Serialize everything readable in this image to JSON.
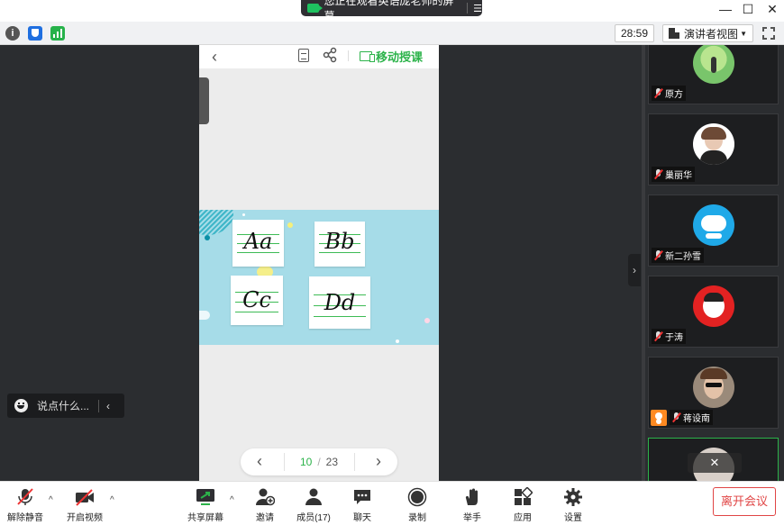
{
  "window": {
    "share_banner": "您正在观看英语庞老师的屏幕",
    "share_banner_menu": "☰",
    "minimize": "—",
    "maximize": "☐",
    "close": "✕"
  },
  "infobar": {
    "info_icon": "i",
    "timer": "28:59",
    "view_mode": "演讲者视图"
  },
  "shared_screen": {
    "mobile_teach": "移动授课",
    "cards": [
      "Aa",
      "Bb",
      "Cc",
      "Dd"
    ],
    "pager": {
      "current": "10",
      "separator": "/",
      "total": "23"
    }
  },
  "chat": {
    "placeholder": "说点什么..."
  },
  "participants": [
    {
      "name": "原方"
    },
    {
      "name": "巢丽华"
    },
    {
      "name": "新二孙雪"
    },
    {
      "name": "于涛"
    },
    {
      "name": "蒋设南"
    },
    {
      "name": ""
    }
  ],
  "toolbar": {
    "unmute": "解除静音",
    "start_video": "开启视频",
    "share_screen": "共享屏幕",
    "invite": "邀请",
    "members": "成员(17)",
    "chat": "聊天",
    "record": "录制",
    "raise_hand": "举手",
    "apps": "应用",
    "settings": "设置",
    "leave": "离开会议"
  },
  "colors": {
    "accent_green": "#2cb34a",
    "leave_red": "#e04545",
    "host_orange": "#ff8a22"
  }
}
